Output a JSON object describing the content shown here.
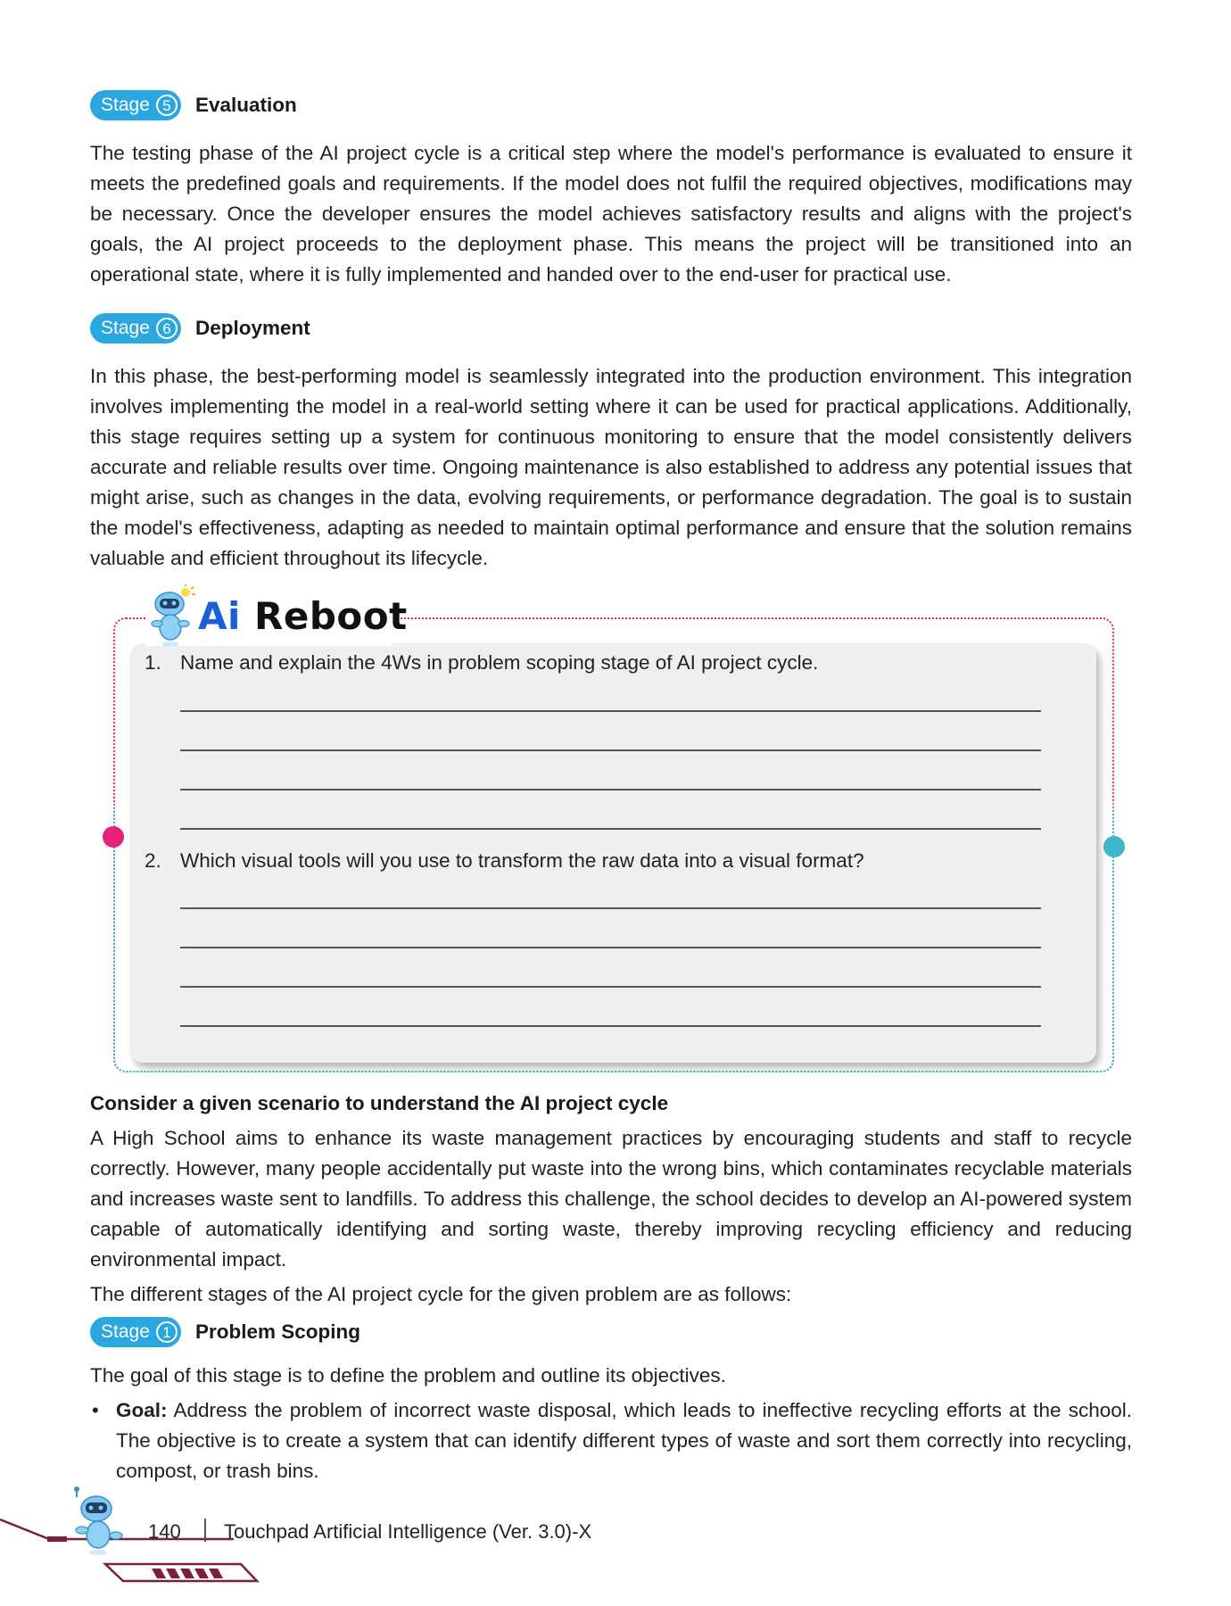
{
  "stage5": {
    "stage_label": "Stage",
    "number": "5",
    "title": "Evaluation",
    "paragraph": "The testing phase of the AI project cycle is a critical step where the model's performance is evaluated to ensure it meets the predefined goals and requirements. If the model does not fulfil the required objectives, modifications may be necessary. Once the developer ensures the model achieves satisfactory results and aligns with the project's goals, the AI project proceeds to the deployment phase. This means the project will be transitioned into an operational state, where it is fully implemented and handed over to the end-user for practical use."
  },
  "stage6": {
    "stage_label": "Stage",
    "number": "6",
    "title": "Deployment",
    "paragraph": "In this phase, the best-performing model is seamlessly integrated into the production environment. This integration involves implementing the model in a real-world setting where it can be used for practical applications. Additionally, this stage requires setting up a system for continuous monitoring to ensure that the model consistently delivers accurate and reliable results over time. Ongoing maintenance is also established to address any potential issues that might arise, such as changes in the data, evolving requirements, or performance degradation. The goal is to sustain the model's effectiveness, adapting as needed to maintain optimal performance and ensure that the solution remains valuable and efficient throughout its lifecycle."
  },
  "reboot": {
    "title_ai": "Ai",
    "title_rest": "Reboot",
    "questions": [
      {
        "num": "1.",
        "text": "Name and explain the 4Ws in problem scoping stage of AI project cycle."
      },
      {
        "num": "2.",
        "text": "Which visual tools will you use to transform the raw data into a visual format?"
      }
    ]
  },
  "scenario": {
    "heading": "Consider a given scenario to understand the AI project cycle",
    "paragraph": "A High School aims to enhance its waste management practices by encouraging students and staff to recycle correctly. However, many people accidentally put waste into the wrong bins, which contaminates recyclable materials and increases waste sent to landfills. To address this challenge, the school decides to develop an AI-powered system capable of automatically identifying and sorting waste, thereby improving recycling efficiency and reducing environmental impact.",
    "stages_intro": "The different stages of the AI project cycle for the given problem are as follows:"
  },
  "stage1": {
    "stage_label": "Stage",
    "number": "1",
    "title": "Problem Scoping",
    "intro": "The goal of this stage is to define the problem and outline its objectives.",
    "bullet_label": "Goal:",
    "bullet_text": " Address the problem of incorrect waste disposal, which leads to ineffective recycling efforts at the school. The objective is to create a system that can identify different types of waste and sort them correctly into recycling, compost, or trash bins."
  },
  "footer": {
    "page_number": "140",
    "book_title": "Touchpad Artificial Intelligence (Ver. 3.0)-X"
  },
  "colors": {
    "stage_pill": "#2aa7df",
    "frame_pink": "#e6217a",
    "frame_cyan": "#3bb8c9",
    "ai_blue": "#1a5fd6",
    "footer_maroon": "#7a1f3d"
  }
}
